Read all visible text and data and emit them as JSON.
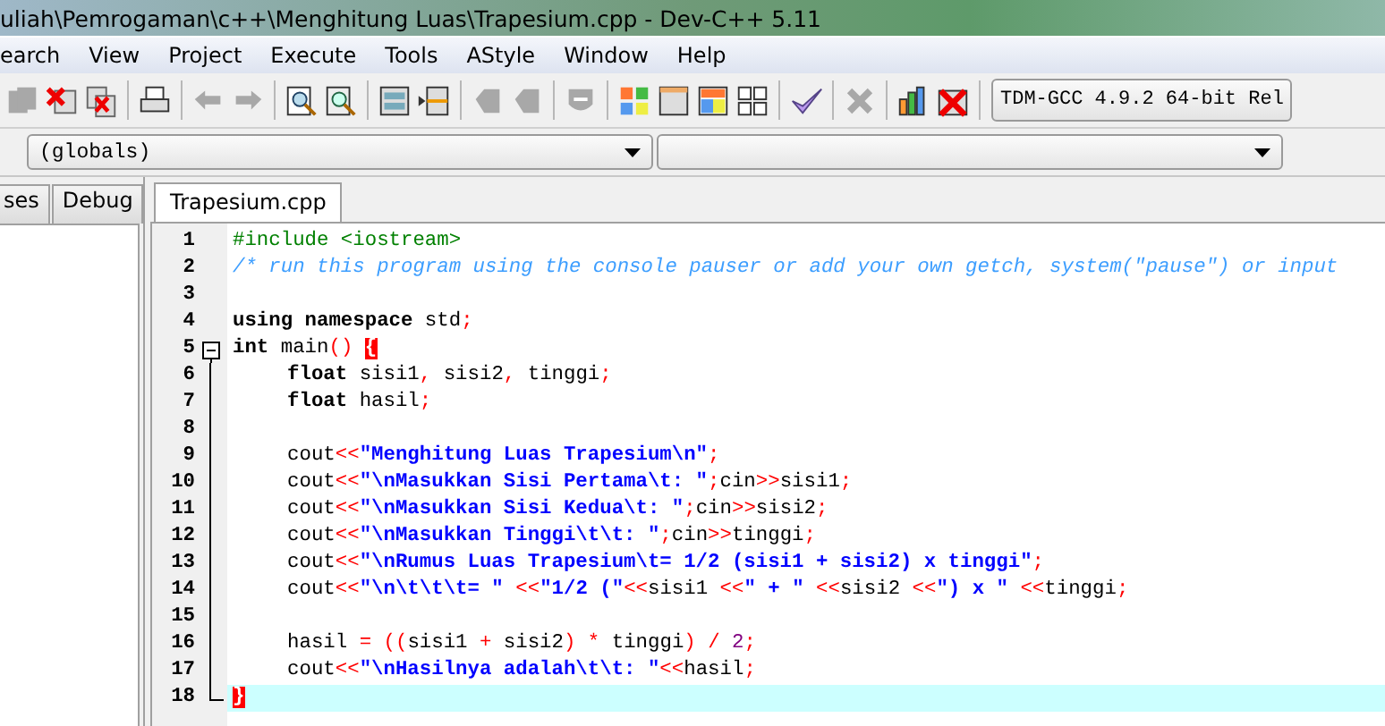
{
  "window": {
    "title": "uliah\\Pemrogaman\\c++\\Menghitung Luas\\Trapesium.cpp - Dev-C++ 5.11"
  },
  "menu": [
    "earch",
    "View",
    "Project",
    "Execute",
    "Tools",
    "AStyle",
    "Window",
    "Help"
  ],
  "compiler": {
    "value": "TDM-GCC 4.9.2 64-bit Rel"
  },
  "scope": {
    "value": "(globals)"
  },
  "left_tabs": [
    {
      "label": "ses",
      "selected": false
    },
    {
      "label": "Debug",
      "selected": false
    }
  ],
  "editor_tabs": [
    {
      "label": "Trapesium.cpp",
      "selected": true
    }
  ],
  "lines": [
    {
      "number": "1",
      "selected": false,
      "kind": "plain",
      "indented": false,
      "tokens": [
        {
          "kind": "preprocessor",
          "text": "#include <iostream>"
        }
      ]
    },
    {
      "number": "2",
      "selected": false,
      "kind": "plain",
      "indented": false,
      "tokens": [
        {
          "kind": "comment",
          "text": "/* run this program using the console pauser or add your own getch, system(\"pause\") or input"
        }
      ]
    },
    {
      "number": "3",
      "selected": false,
      "kind": "plain"
    },
    {
      "number": "4",
      "selected": false,
      "kind": "plain",
      "indented": false,
      "tokens": [
        {
          "kind": "keyword",
          "text": "using namespace"
        },
        {
          "kind": "plain",
          "text": " std"
        },
        {
          "kind": "symbol",
          "text": ";"
        }
      ]
    },
    {
      "number": "5",
      "selected": false,
      "kind": "fold-start",
      "indented": false,
      "tokens": [
        {
          "kind": "keyword",
          "text": "int"
        },
        {
          "kind": "plain",
          "text": " main"
        },
        {
          "kind": "symbol",
          "text": "() "
        },
        {
          "kind": "brace",
          "text": "{"
        }
      ]
    },
    {
      "number": "6",
      "selected": false,
      "kind": "fold-body",
      "indented": true,
      "tokens": [
        {
          "kind": "keyword",
          "text": "float"
        },
        {
          "kind": "plain",
          "text": " sisi1"
        },
        {
          "kind": "symbol",
          "text": ","
        },
        {
          "kind": "plain",
          "text": " sisi2"
        },
        {
          "kind": "symbol",
          "text": ","
        },
        {
          "kind": "plain",
          "text": " tinggi"
        },
        {
          "kind": "symbol",
          "text": ";"
        }
      ]
    },
    {
      "number": "7",
      "selected": false,
      "kind": "fold-body",
      "indented": true,
      "tokens": [
        {
          "kind": "keyword",
          "text": "float"
        },
        {
          "kind": "plain",
          "text": " hasil"
        },
        {
          "kind": "symbol",
          "text": ";"
        }
      ]
    },
    {
      "number": "8",
      "selected": false,
      "kind": "fold-body"
    },
    {
      "number": "9",
      "selected": false,
      "kind": "fold-body",
      "indented": true,
      "tokens": [
        {
          "kind": "plain",
          "text": "cout"
        },
        {
          "kind": "symbol",
          "text": "<<"
        },
        {
          "kind": "string",
          "text": "\"Menghitung Luas Trapesium\\n\""
        },
        {
          "kind": "symbol",
          "text": ";"
        }
      ]
    },
    {
      "number": "10",
      "selected": false,
      "kind": "fold-body",
      "indented": true,
      "tokens": [
        {
          "kind": "plain",
          "text": "cout"
        },
        {
          "kind": "symbol",
          "text": "<<"
        },
        {
          "kind": "string",
          "text": "\"\\nMasukkan Sisi Pertama\\t: \""
        },
        {
          "kind": "symbol",
          "text": ";"
        },
        {
          "kind": "plain",
          "text": "cin"
        },
        {
          "kind": "symbol",
          "text": ">>"
        },
        {
          "kind": "plain",
          "text": "sisi1"
        },
        {
          "kind": "symbol",
          "text": ";"
        }
      ]
    },
    {
      "number": "11",
      "selected": false,
      "kind": "fold-body",
      "indented": true,
      "tokens": [
        {
          "kind": "plain",
          "text": "cout"
        },
        {
          "kind": "symbol",
          "text": "<<"
        },
        {
          "kind": "string",
          "text": "\"\\nMasukkan Sisi Kedua\\t: \""
        },
        {
          "kind": "symbol",
          "text": ";"
        },
        {
          "kind": "plain",
          "text": "cin"
        },
        {
          "kind": "symbol",
          "text": ">>"
        },
        {
          "kind": "plain",
          "text": "sisi2"
        },
        {
          "kind": "symbol",
          "text": ";"
        }
      ]
    },
    {
      "number": "12",
      "selected": false,
      "kind": "fold-body",
      "indented": true,
      "tokens": [
        {
          "kind": "plain",
          "text": "cout"
        },
        {
          "kind": "symbol",
          "text": "<<"
        },
        {
          "kind": "string",
          "text": "\"\\nMasukkan Tinggi\\t\\t: \""
        },
        {
          "kind": "symbol",
          "text": ";"
        },
        {
          "kind": "plain",
          "text": "cin"
        },
        {
          "kind": "symbol",
          "text": ">>"
        },
        {
          "kind": "plain",
          "text": "tinggi"
        },
        {
          "kind": "symbol",
          "text": ";"
        }
      ]
    },
    {
      "number": "13",
      "selected": false,
      "kind": "fold-body",
      "indented": true,
      "tokens": [
        {
          "kind": "plain",
          "text": "cout"
        },
        {
          "kind": "symbol",
          "text": "<<"
        },
        {
          "kind": "string",
          "text": "\"\\nRumus Luas Trapesium\\t= 1/2 (sisi1 + sisi2) x tinggi\""
        },
        {
          "kind": "symbol",
          "text": ";"
        }
      ]
    },
    {
      "number": "14",
      "selected": false,
      "kind": "fold-body",
      "indented": true,
      "tokens": [
        {
          "kind": "plain",
          "text": "cout"
        },
        {
          "kind": "symbol",
          "text": "<<"
        },
        {
          "kind": "string",
          "text": "\"\\n\\t\\t\\t= \""
        },
        {
          "kind": "symbol",
          "text": " <<"
        },
        {
          "kind": "string",
          "text": "\"1/2 (\""
        },
        {
          "kind": "symbol",
          "text": "<<"
        },
        {
          "kind": "plain",
          "text": "sisi1 "
        },
        {
          "kind": "symbol",
          "text": "<<"
        },
        {
          "kind": "string",
          "text": "\" + \""
        },
        {
          "kind": "symbol",
          "text": " <<"
        },
        {
          "kind": "plain",
          "text": "sisi2 "
        },
        {
          "kind": "symbol",
          "text": "<<"
        },
        {
          "kind": "string",
          "text": "\") x \""
        },
        {
          "kind": "symbol",
          "text": " <<"
        },
        {
          "kind": "plain",
          "text": "tinggi"
        },
        {
          "kind": "symbol",
          "text": ";"
        }
      ]
    },
    {
      "number": "15",
      "selected": false,
      "kind": "fold-body"
    },
    {
      "number": "16",
      "selected": false,
      "kind": "fold-body",
      "indented": true,
      "tokens": [
        {
          "kind": "plain",
          "text": "hasil "
        },
        {
          "kind": "symbol",
          "text": "= (("
        },
        {
          "kind": "plain",
          "text": "sisi1 "
        },
        {
          "kind": "symbol",
          "text": "+"
        },
        {
          "kind": "plain",
          "text": " sisi2"
        },
        {
          "kind": "symbol",
          "text": ") *"
        },
        {
          "kind": "plain",
          "text": " tinggi"
        },
        {
          "kind": "symbol",
          "text": ") / "
        },
        {
          "kind": "number",
          "text": "2"
        },
        {
          "kind": "symbol",
          "text": ";"
        }
      ]
    },
    {
      "number": "17",
      "selected": false,
      "kind": "fold-body",
      "indented": true,
      "tokens": [
        {
          "kind": "plain",
          "text": "cout"
        },
        {
          "kind": "symbol",
          "text": "<<"
        },
        {
          "kind": "string",
          "text": "\"\\nHasilnya adalah\\t\\t: \""
        },
        {
          "kind": "symbol",
          "text": "<<"
        },
        {
          "kind": "plain",
          "text": "hasil"
        },
        {
          "kind": "symbol",
          "text": ";"
        }
      ]
    },
    {
      "number": "18",
      "selected": true,
      "kind": "fold-end",
      "indented": false,
      "tokens": [
        {
          "kind": "brace",
          "text": "}"
        }
      ]
    }
  ]
}
